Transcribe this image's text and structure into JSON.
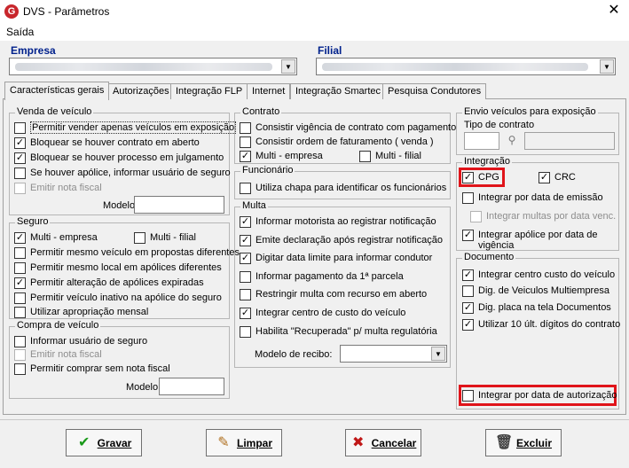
{
  "window": {
    "title": "DVS - Parâmetros",
    "close_glyph": "✕",
    "app_icon": "G"
  },
  "menu": {
    "items": [
      "Saída"
    ]
  },
  "header": {
    "empresa_label": "Empresa",
    "filial_label": "Filial"
  },
  "tabs": [
    "Características gerais",
    "Autorizações",
    "Integração FLP",
    "Internet",
    "Integração Smartec",
    "Pesquisa Condutores"
  ],
  "venda": {
    "title": "Venda de veículo",
    "items": [
      {
        "label": "Permitir vender apenas veículos em exposição",
        "checked": false,
        "disabled": false
      },
      {
        "label": "Bloquear se houver contrato em aberto",
        "checked": true,
        "disabled": false
      },
      {
        "label": "Bloquear se houver processo em julgamento",
        "checked": true,
        "disabled": false
      },
      {
        "label": "Se houver apólice, informar usuário de seguro",
        "checked": false,
        "disabled": false
      },
      {
        "label": "Emitir nota fiscal",
        "checked": false,
        "disabled": true
      }
    ],
    "modelo_label": "Modelo"
  },
  "seguro": {
    "title": "Seguro",
    "multi_empresa": "Multi - empresa",
    "multi_filial": "Multi - filial",
    "items": [
      {
        "label": "Permitir mesmo veículo em propostas diferentes",
        "checked": false
      },
      {
        "label": "Permitir mesmo local em apólices diferentes",
        "checked": false
      },
      {
        "label": "Permitir alteração de apólices expiradas",
        "checked": true
      },
      {
        "label": "Permitir veículo inativo na apólice do seguro",
        "checked": false
      },
      {
        "label": "Utilizar apropriação mensal",
        "checked": false
      }
    ]
  },
  "compra": {
    "title": "Compra de veículo",
    "items": [
      {
        "label": "Informar usuário de seguro",
        "checked": false,
        "disabled": false
      },
      {
        "label": "Emitir nota fiscal",
        "checked": false,
        "disabled": true
      },
      {
        "label": "Permitir comprar sem nota fiscal",
        "checked": false,
        "disabled": false
      }
    ],
    "modelo_label": "Modelo"
  },
  "contrato": {
    "title": "Contrato",
    "items": [
      {
        "label": "Consistir vigência de contrato com pagamento",
        "checked": false
      },
      {
        "label": "Consistir ordem de faturamento ( venda )",
        "checked": false
      }
    ],
    "multi_empresa": "Multi - empresa",
    "multi_filial": "Multi - filial"
  },
  "funcionario": {
    "title": "Funcionário",
    "label": "Utiliza chapa para identificar os funcionários"
  },
  "multa": {
    "title": "Multa",
    "items": [
      {
        "label": "Informar motorista ao registrar notificação",
        "checked": true
      },
      {
        "label": "Emite declaração após registrar notificação",
        "checked": true
      },
      {
        "label": "Digitar data limite para informar condutor",
        "checked": true
      },
      {
        "label": "Informar pagamento da 1ª parcela",
        "checked": false
      },
      {
        "label": "Restringir multa com recurso em aberto",
        "checked": false
      },
      {
        "label": "Integrar centro de custo do veículo",
        "checked": true
      },
      {
        "label": "Habilita \"Recuperada\" p/ multa regulatória",
        "checked": false
      }
    ],
    "modelo_recibo_label": "Modelo de recibo:"
  },
  "envio": {
    "title": "Envio veículos para exposição",
    "tipo_label": "Tipo de contrato"
  },
  "integracao": {
    "title": "Integração",
    "cpg": "CPG",
    "crc": "CRC",
    "items": [
      {
        "label": "Integrar por data de emissão",
        "checked": false,
        "disabled": false
      },
      {
        "label": "Integrar multas por data venc.",
        "checked": false,
        "disabled": true
      },
      {
        "label": "Integrar apólice por data de",
        "label2": "vigência",
        "checked": true,
        "disabled": false
      }
    ]
  },
  "documento": {
    "title": "Documento",
    "items": [
      {
        "label": "Integrar centro custo do veículo",
        "checked": true
      },
      {
        "label": "Dig. de Veiculos Multiempresa",
        "checked": false
      },
      {
        "label": "Dig. placa na tela Documentos",
        "checked": true
      },
      {
        "label": "Utilizar 10 últ. dígitos do contrato",
        "checked": true
      }
    ],
    "autorizacao": "Integrar por data de autorização"
  },
  "buttons": {
    "gravar": "Gravar",
    "limpar": "Limpar",
    "cancelar": "Cancelar",
    "excluir": "Excluir"
  },
  "colors": {
    "highlight": "#e0141a",
    "section_label": "#00218c"
  }
}
